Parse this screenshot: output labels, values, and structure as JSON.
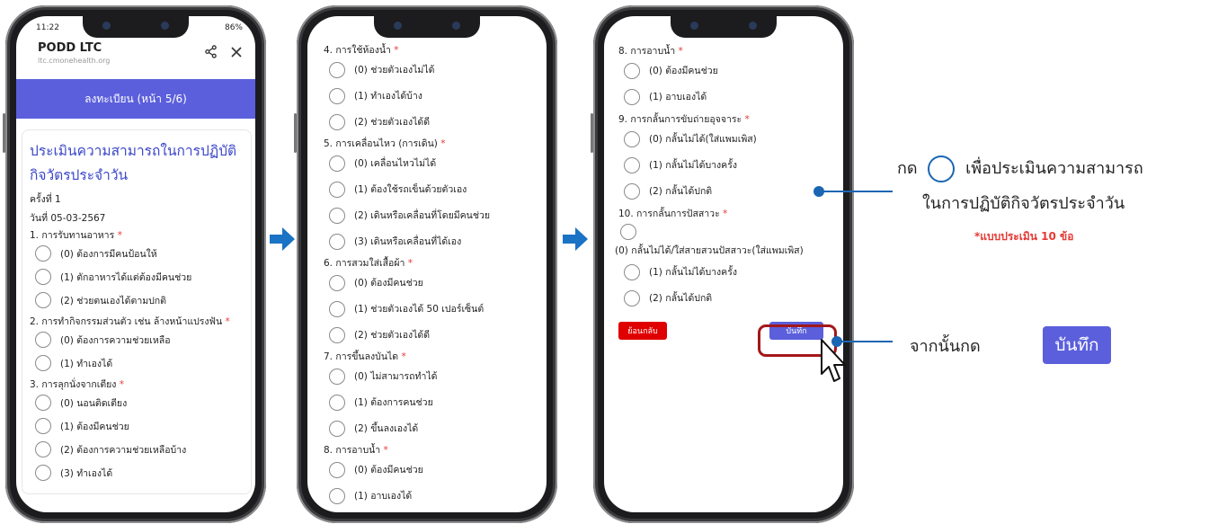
{
  "phone1": {
    "status_time": "11:22",
    "status_right": "86%",
    "app_title": "PODD LTC",
    "app_url": "ltc.cmonehealth.org",
    "share_icon": "share-icon",
    "close_icon": "close-icon",
    "banner": "ลงทะเบียน (หน้า 5/6)",
    "form_title": "ประเมินความสามารถในการปฏิบัติกิจวัตรประจำวัน",
    "round": "ครั้งที่ 1",
    "date": "วันที่ 05-03-2567",
    "questions": [
      {
        "label": "1. การรับทานอาหาร",
        "options": [
          "(0) ต้องการมีคนป้อนให้",
          "(1) ตักอาหารได้แต่ต้องมีคนช่วย",
          "(2) ช่วยตนเองได้ตามปกติ"
        ]
      },
      {
        "label": "2. การทำกิจกรรมส่วนตัว เช่น ล้างหน้าแปรงฟัน",
        "options": [
          "(0) ต้องการความช่วยเหลือ",
          "(1) ทำเองได้"
        ]
      },
      {
        "label": "3. การลุกนั่งจากเตียง",
        "options": [
          "(0) นอนติดเตียง",
          "(1) ต้องมีคนช่วย",
          "(2) ต้องการความช่วยเหลือบ้าง",
          "(3) ทำเองได้"
        ]
      }
    ]
  },
  "phone2": {
    "questions": [
      {
        "label": "4. การใช้ห้องน้ำ",
        "options": [
          "(0) ช่วยตัวเองไม่ได้",
          "(1) ทำเองได้บ้าง",
          "(2) ช่วยตัวเองได้ดี"
        ]
      },
      {
        "label": "5. การเคลื่อนไหว (การเดิน)",
        "options": [
          "(0) เคลื่อนไหวไม่ได้",
          "(1) ต้องใช้รถเข็นด้วยตัวเอง",
          "(2) เดินหรือเคลื่อนที่โดยมีคนช่วย",
          "(3) เดินหรือเคลื่อนที่ได้เอง"
        ]
      },
      {
        "label": "6. การสวมใส่เสื้อผ้า",
        "options": [
          "(0) ต้องมีคนช่วย",
          "(1) ช่วยตัวเองได้ 50 เปอร์เซ็นต์",
          "(2) ช่วยตัวเองได้ดี"
        ]
      },
      {
        "label": "7. การขึ้นลงบันได",
        "options": [
          "(0) ไม่สามารถทำได้",
          "(1) ต้องการคนช่วย",
          "(2) ขึ้นลงเองได้"
        ]
      },
      {
        "label": "8. การอาบน้ำ",
        "options": [
          "(0) ต้องมีคนช่วย",
          "(1) อาบเองได้"
        ]
      }
    ]
  },
  "phone3": {
    "questions": [
      {
        "label": "8. การอาบน้ำ",
        "options": [
          "(0) ต้องมีคนช่วย",
          "(1) อาบเองได้"
        ]
      },
      {
        "label": "9. การกลั้นการขับถ่ายอุจจาระ",
        "options": [
          "(0) กลั้นไม่ได้(ใส่แพมเพิส)",
          "(1) กลั้นไม่ได้บางครั้ง",
          "(2) กลั้นได้ปกติ"
        ]
      },
      {
        "label": "10. การกลั้นการปัสสาวะ",
        "first_option": "(0) กลั้นไม่ได้/ใส่สายสวนปัสสาวะ(ใส่แพมเพิส)",
        "options": [
          "(1) กลั้นไม่ได้บางครั้ง",
          "(2) กลั้นได้ปกติ"
        ]
      }
    ],
    "back_button": "ย้อนกลับ",
    "save_button": "บันทึก"
  },
  "annotations": {
    "press_prefix": "กด",
    "press_suffix": "เพื่อประเมินความสามารถ",
    "press_line2": "ในการปฏิบัติกิจวัตรประจำวัน",
    "note": "*แบบประเมิน 10 ข้อ",
    "then_press": "จากนั้นกด",
    "save_label": "บันทึก"
  },
  "colors": {
    "accent": "#5b5fdc",
    "required": "#e53935",
    "back": "#e00000",
    "callout": "#1a66b3",
    "arrow": "#1a73c4"
  }
}
